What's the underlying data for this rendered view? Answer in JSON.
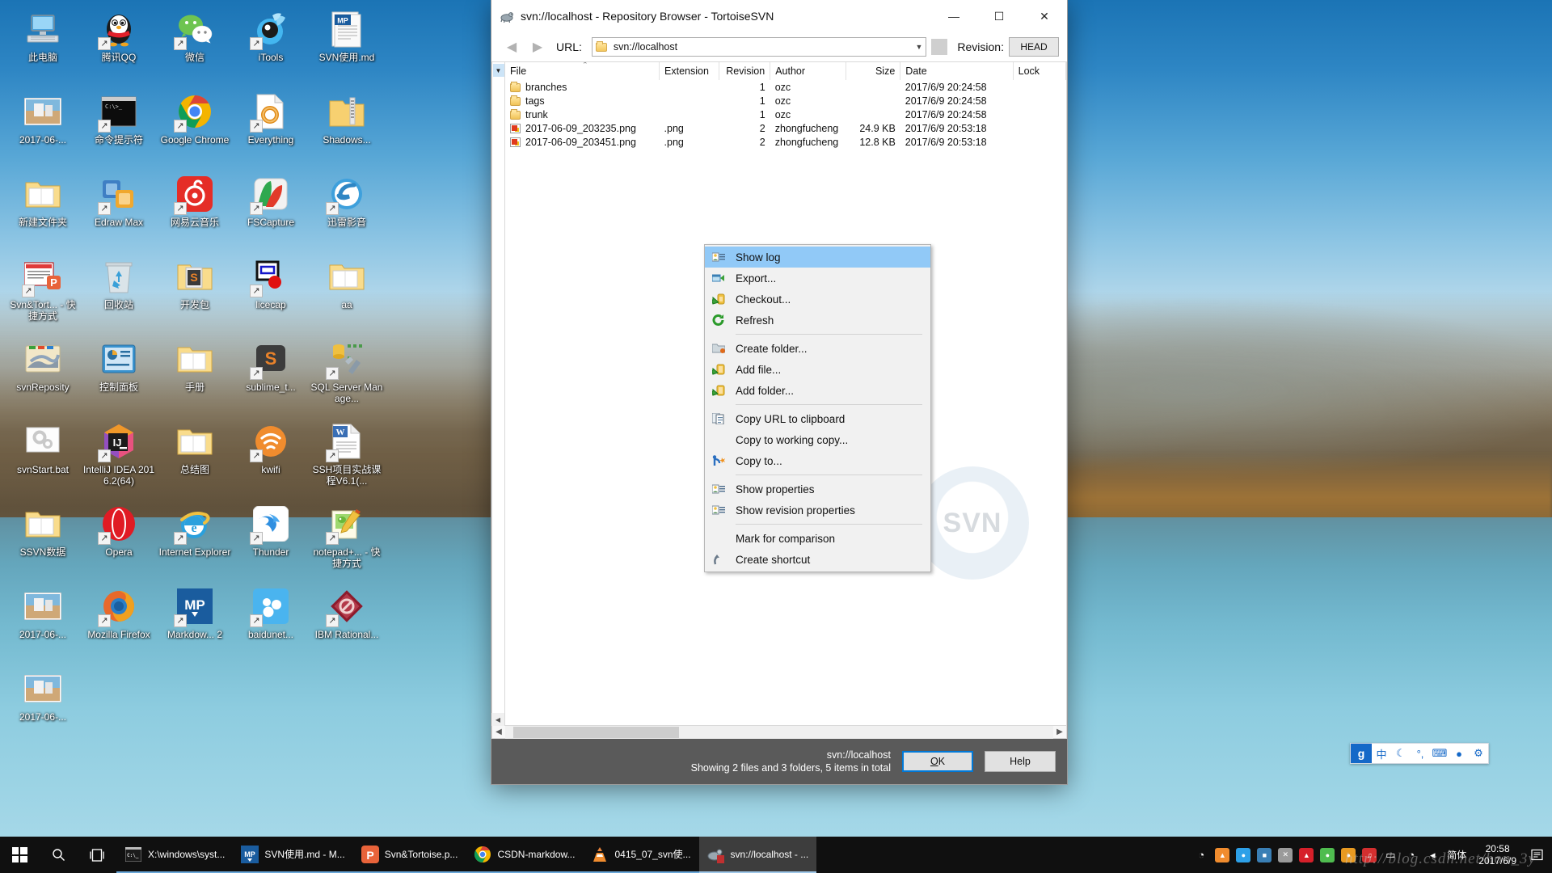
{
  "desktop": {
    "icons": [
      {
        "label": "此电脑",
        "icon": "this-pc-icon",
        "shortcut": false
      },
      {
        "label": "腾讯QQ",
        "icon": "qq-penguin-icon",
        "shortcut": true
      },
      {
        "label": "微信",
        "icon": "wechat-icon",
        "shortcut": true
      },
      {
        "label": "iTools",
        "icon": "itools-icon",
        "shortcut": true
      },
      {
        "label": "SVN使用.md",
        "icon": "markdown-file-icon",
        "shortcut": false
      },
      {
        "label": "2017-06-...",
        "icon": "image-thumbnail-icon",
        "shortcut": false
      },
      {
        "label": "命令提示符",
        "icon": "command-prompt-icon",
        "shortcut": true
      },
      {
        "label": "Google Chrome",
        "icon": "chrome-icon",
        "shortcut": true
      },
      {
        "label": "Everything",
        "icon": "everything-icon",
        "shortcut": true
      },
      {
        "label": "Shadows...",
        "icon": "zip-folder-icon",
        "shortcut": false
      },
      {
        "label": "新建文件夹",
        "icon": "folder-icon",
        "shortcut": false
      },
      {
        "label": "Edraw Max",
        "icon": "edraw-max-icon",
        "shortcut": true
      },
      {
        "label": "网易云音乐",
        "icon": "netease-music-icon",
        "shortcut": true
      },
      {
        "label": "FSCapture",
        "icon": "fscapture-icon",
        "shortcut": true
      },
      {
        "label": "迅雷影音",
        "icon": "xunlei-player-icon",
        "shortcut": true
      },
      {
        "label": "Svn&Tort... - 快捷方式",
        "icon": "powerpoint-file-icon",
        "shortcut": true
      },
      {
        "label": "回收站",
        "icon": "recycle-bin-icon",
        "shortcut": false
      },
      {
        "label": "开发包",
        "icon": "sublime-folder-icon",
        "shortcut": false
      },
      {
        "label": "licecap",
        "icon": "licecap-icon",
        "shortcut": true
      },
      {
        "label": "aa",
        "icon": "folder-icon",
        "shortcut": false
      },
      {
        "label": "svnReposity",
        "icon": "svn-repository-folder-icon",
        "shortcut": false
      },
      {
        "label": "控制面板",
        "icon": "control-panel-icon",
        "shortcut": false
      },
      {
        "label": "手册",
        "icon": "folder-icon",
        "shortcut": false
      },
      {
        "label": "sublime_t...",
        "icon": "sublime-text-icon",
        "shortcut": true
      },
      {
        "label": "SQL Server Manage...",
        "icon": "sql-server-icon",
        "shortcut": true
      },
      {
        "label": "svnStart.bat",
        "icon": "bat-file-icon",
        "shortcut": false
      },
      {
        "label": "IntelliJ IDEA 2016.2(64)",
        "icon": "intellij-idea-icon",
        "shortcut": true
      },
      {
        "label": "总结图",
        "icon": "folder-icon",
        "shortcut": false
      },
      {
        "label": "kwifi",
        "icon": "kwifi-icon",
        "shortcut": true
      },
      {
        "label": "SSH项目实战课程V6.1(...",
        "icon": "word-document-icon",
        "shortcut": true
      },
      {
        "label": "SSVN数据",
        "icon": "folder-icon",
        "shortcut": false
      },
      {
        "label": "Opera",
        "icon": "opera-icon",
        "shortcut": true
      },
      {
        "label": "Internet Explorer",
        "icon": "internet-explorer-icon",
        "shortcut": true
      },
      {
        "label": "Thunder",
        "icon": "thunder-icon",
        "shortcut": true
      },
      {
        "label": "notepad+... - 快捷方式",
        "icon": "notepad-plus-plus-icon",
        "shortcut": true
      },
      {
        "label": "2017-06-...",
        "icon": "image-thumbnail-icon",
        "shortcut": false
      },
      {
        "label": "Mozilla Firefox",
        "icon": "firefox-icon",
        "shortcut": true
      },
      {
        "label": "Markdow... 2",
        "icon": "markdownpad-icon",
        "shortcut": true
      },
      {
        "label": "baidunet...",
        "icon": "baidu-netdisk-icon",
        "shortcut": true
      },
      {
        "label": "IBM Rational...",
        "icon": "ibm-rational-icon",
        "shortcut": true
      },
      {
        "label": "2017-06-...",
        "icon": "image-thumbnail-icon",
        "shortcut": false
      }
    ]
  },
  "window": {
    "title": "svn://localhost - Repository Browser - TortoiseSVN",
    "app_icon": "tortoisesvn-icon",
    "controls": {
      "minimize": "—",
      "maximize": "☐",
      "close": "✕"
    },
    "toolbar": {
      "back_icon": "arrow-left-icon",
      "forward_icon": "arrow-right-icon",
      "url_label": "URL:",
      "url_value": "svn://localhost",
      "url_placeholder": "svn://",
      "revision_label": "Revision:",
      "revision_value": "HEAD"
    },
    "list": {
      "columns": [
        "File",
        "Extension",
        "Revision",
        "Author",
        "Size",
        "Date",
        "Lock"
      ],
      "sort_column": "File",
      "sort_direction": "asc",
      "rows": [
        {
          "file": "branches",
          "icon": "folder-icon",
          "extension": "",
          "revision": "1",
          "author": "ozc",
          "size": "",
          "date": "2017/6/9 20:24:58",
          "lock": ""
        },
        {
          "file": "tags",
          "icon": "folder-icon",
          "extension": "",
          "revision": "1",
          "author": "ozc",
          "size": "",
          "date": "2017/6/9 20:24:58",
          "lock": ""
        },
        {
          "file": "trunk",
          "icon": "folder-icon",
          "extension": "",
          "revision": "1",
          "author": "ozc",
          "size": "",
          "date": "2017/6/9 20:24:58",
          "lock": ""
        },
        {
          "file": "2017-06-09_203235.png",
          "icon": "png-file-icon",
          "extension": ".png",
          "revision": "2",
          "author": "zhongfucheng",
          "size": "24.9 KB",
          "date": "2017/6/9 20:53:18",
          "lock": ""
        },
        {
          "file": "2017-06-09_203451.png",
          "icon": "png-file-icon",
          "extension": ".png",
          "revision": "2",
          "author": "zhongfucheng",
          "size": "12.8 KB",
          "date": "2017/6/9 20:53:18",
          "lock": ""
        }
      ]
    },
    "status": {
      "url": "svn://localhost",
      "summary": "Showing 2 files and 3 folders, 5 items in total",
      "ok_label": "OK",
      "ok_accesskey": "O",
      "ok_rest": "K",
      "help_label": "Help"
    },
    "watermark": "SVN"
  },
  "context_menu": {
    "selected": "Show log",
    "groups": [
      [
        {
          "label": "Show log",
          "icon": "show-log-icon",
          "selected": true
        },
        {
          "label": "Export...",
          "icon": "export-icon",
          "selected": false
        },
        {
          "label": "Checkout...",
          "icon": "checkout-icon",
          "selected": false
        },
        {
          "label": "Refresh",
          "icon": "refresh-icon",
          "selected": false
        }
      ],
      [
        {
          "label": "Create folder...",
          "icon": "create-folder-icon",
          "selected": false
        },
        {
          "label": "Add file...",
          "icon": "add-file-icon",
          "selected": false
        },
        {
          "label": "Add folder...",
          "icon": "add-folder-icon",
          "selected": false
        }
      ],
      [
        {
          "label": "Copy URL to clipboard",
          "icon": "copy-clipboard-icon",
          "selected": false
        },
        {
          "label": "Copy to working copy...",
          "icon": "none",
          "selected": false
        },
        {
          "label": "Copy to...",
          "icon": "copy-to-icon",
          "selected": false
        }
      ],
      [
        {
          "label": "Show properties",
          "icon": "properties-icon",
          "selected": false
        },
        {
          "label": "Show revision properties",
          "icon": "revision-properties-icon",
          "selected": false
        }
      ],
      [
        {
          "label": "Mark for comparison",
          "icon": "none",
          "selected": false
        },
        {
          "label": "Create shortcut",
          "icon": "create-shortcut-icon",
          "selected": false
        }
      ]
    ]
  },
  "taskbar": {
    "start_icon": "windows-logo-icon",
    "search_icon": "search-icon",
    "taskview_icon": "task-view-icon",
    "apps": [
      {
        "label": "X:\\windows\\syst...",
        "icon": "command-prompt-icon",
        "color": "#2b2b2b",
        "glyph": "C:\\",
        "active": false
      },
      {
        "label": "SVN使用.md - M...",
        "icon": "markdownpad-icon",
        "color": "#1a5c9e",
        "glyph": "MP",
        "active": false
      },
      {
        "label": "Svn&Tortoise.p...",
        "icon": "powerpoint-icon",
        "color": "#e8633a",
        "glyph": "P",
        "active": false
      },
      {
        "label": "CSDN-markdow...",
        "icon": "chrome-icon",
        "color": "#ffffff",
        "glyph": "",
        "active": false
      },
      {
        "label": "0415_07_svn使...",
        "icon": "vlc-icon",
        "color": "#0f0f0f",
        "glyph": "",
        "active": false
      },
      {
        "label": "svn://localhost - ...",
        "icon": "tortoisesvn-icon",
        "color": "#0f0f0f",
        "glyph": "",
        "active": true
      }
    ],
    "tray": [
      {
        "icon": "wifi-icon",
        "glyph": "◔",
        "color": ""
      },
      {
        "icon": "vlc-icon",
        "glyph": "▲",
        "color": "#f08c2e"
      },
      {
        "icon": "baidu-netdisk-icon",
        "glyph": "●",
        "color": "#2da0e8"
      },
      {
        "icon": "app-icon-green",
        "glyph": "■",
        "color": "#3a7fb5"
      },
      {
        "icon": "close-red-x-icon",
        "glyph": "✕",
        "color": "#9a9a9a"
      },
      {
        "icon": "red-triangle-icon",
        "glyph": "▲",
        "color": "#d6202a"
      },
      {
        "icon": "wechat-icon",
        "glyph": "●",
        "color": "#4fbc4f"
      },
      {
        "icon": "search-app-icon",
        "glyph": "●",
        "color": "#e89a22"
      },
      {
        "icon": "netease-music-icon",
        "glyph": "♫",
        "color": "#d32f2f"
      },
      {
        "icon": "battery-icon",
        "glyph": "▭",
        "color": ""
      },
      {
        "icon": "network-icon",
        "glyph": "◔",
        "color": ""
      },
      {
        "icon": "volume-icon",
        "glyph": "◂",
        "color": ""
      }
    ],
    "ime_tray_label": "简体",
    "clock_time": "20:58",
    "clock_date": "2017/6/9",
    "notification_icon": "action-center-icon"
  },
  "ime_bar": {
    "logo": "g",
    "items": [
      {
        "icon": "chinese-mode-icon",
        "glyph": "中"
      },
      {
        "icon": "moon-icon",
        "glyph": "☾"
      },
      {
        "icon": "punctuation-icon",
        "glyph": "°,"
      },
      {
        "icon": "keyboard-icon",
        "glyph": "⌨"
      },
      {
        "icon": "user-icon",
        "glyph": "●"
      },
      {
        "icon": "gear-icon",
        "glyph": "⚙"
      }
    ]
  },
  "watermark_url": "http://blog.csdn.net/hon_3y",
  "colors": {
    "accent": "#0078d7",
    "menu_highlight": "#91c9f7",
    "statusbar_bg": "#5a5a5a",
    "taskbar_bg": "#101010",
    "ime_blue": "#1468c8"
  }
}
